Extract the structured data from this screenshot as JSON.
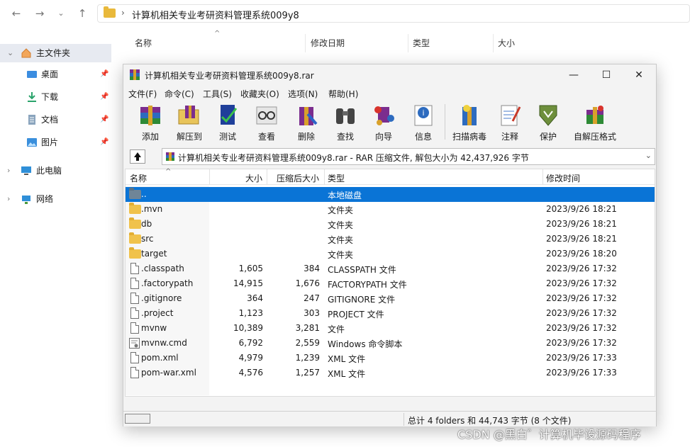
{
  "explorer": {
    "address": "计算机相关专业考研资料管理系统009y8",
    "columns": [
      "名称",
      "修改日期",
      "类型",
      "大小"
    ],
    "sidebar": [
      {
        "label": "主文件夹",
        "icon": "home-icon"
      },
      {
        "label": "桌面",
        "icon": "desktop-icon"
      },
      {
        "label": "下载",
        "icon": "download-icon"
      },
      {
        "label": "文档",
        "icon": "document-icon"
      },
      {
        "label": "图片",
        "icon": "picture-icon"
      },
      {
        "label": "此电脑",
        "icon": "computer-icon"
      },
      {
        "label": "网络",
        "icon": "network-icon"
      }
    ]
  },
  "winrar": {
    "title": "计算机相关专业考研资料管理系统009y8.rar",
    "menu": [
      "文件(F)",
      "命令(C)",
      "工具(S)",
      "收藏夹(O)",
      "选项(N)",
      "帮助(H)"
    ],
    "toolbar": [
      "添加",
      "解压到",
      "测试",
      "查看",
      "删除",
      "查找",
      "向导",
      "信息",
      "扫描病毒",
      "注释",
      "保护",
      "自解压格式"
    ],
    "path": "计算机相关专业考研资料管理系统009y8.rar - RAR 压缩文件, 解包大小为 42,437,926 字节",
    "columns": {
      "name": "名称",
      "size": "大小",
      "packed": "压缩后大小",
      "type": "类型",
      "modified": "修改时间"
    },
    "rows": [
      {
        "name": "..",
        "size": "",
        "packed": "",
        "type": "本地磁盘",
        "modified": ""
      },
      {
        "name": ".mvn",
        "size": "",
        "packed": "",
        "type": "文件夹",
        "modified": "2023/9/26 18:21"
      },
      {
        "name": "db",
        "size": "",
        "packed": "",
        "type": "文件夹",
        "modified": "2023/9/26 18:21"
      },
      {
        "name": "src",
        "size": "",
        "packed": "",
        "type": "文件夹",
        "modified": "2023/9/26 18:21"
      },
      {
        "name": "target",
        "size": "",
        "packed": "",
        "type": "文件夹",
        "modified": "2023/9/26 18:20"
      },
      {
        "name": ".classpath",
        "size": "1,605",
        "packed": "384",
        "type": "CLASSPATH 文件",
        "modified": "2023/9/26 17:32"
      },
      {
        "name": ".factorypath",
        "size": "14,915",
        "packed": "1,676",
        "type": "FACTORYPATH 文件",
        "modified": "2023/9/26 17:32"
      },
      {
        "name": ".gitignore",
        "size": "364",
        "packed": "247",
        "type": "GITIGNORE 文件",
        "modified": "2023/9/26 17:32"
      },
      {
        "name": ".project",
        "size": "1,123",
        "packed": "303",
        "type": "PROJECT 文件",
        "modified": "2023/9/26 17:32"
      },
      {
        "name": "mvnw",
        "size": "10,389",
        "packed": "3,281",
        "type": "文件",
        "modified": "2023/9/26 17:32"
      },
      {
        "name": "mvnw.cmd",
        "size": "6,792",
        "packed": "2,559",
        "type": "Windows 命令脚本",
        "modified": "2023/9/26 17:32"
      },
      {
        "name": "pom.xml",
        "size": "4,979",
        "packed": "1,239",
        "type": "XML 文件",
        "modified": "2023/9/26 17:33"
      },
      {
        "name": "pom-war.xml",
        "size": "4,576",
        "packed": "1,257",
        "type": "XML 文件",
        "modified": "2023/9/26 17:33"
      }
    ],
    "status": "总计 4 folders 和 44,743 字节 (8 个文件)"
  },
  "watermark": "CSDN @黑白゛计算机毕设源码程序"
}
